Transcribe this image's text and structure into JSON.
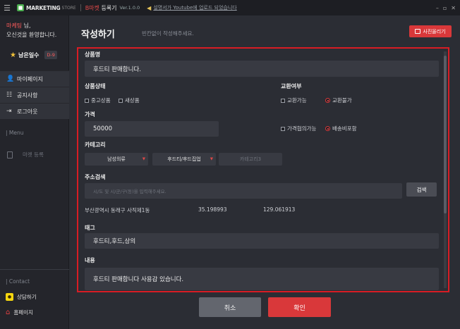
{
  "titlebar": {
    "brand": "MARKETING",
    "brand_sub": "STORE",
    "app_prefix": "B마켓",
    "app_suffix": " 등록기",
    "version": "Ver.1.0.0",
    "notice": "설명서가 Youtube에 업로드 되었습니다"
  },
  "sidebar": {
    "user_name": "마케팅",
    "user_suffix": " 님,",
    "welcome": "오신것을 환영합니다.",
    "days_label": "남은일수",
    "days_value": "D-9",
    "nav": [
      {
        "label": "마이페이지"
      },
      {
        "label": "공지사항"
      },
      {
        "label": "로그아웃"
      }
    ],
    "menu_section": "| Menu",
    "menu_item": "마켓 등록",
    "contact_section": "| Contact",
    "contact_items": [
      {
        "label": "상담하기"
      },
      {
        "label": "홈페이지"
      }
    ]
  },
  "main": {
    "title": "작성하기",
    "description": "빈칸없이 작성해주세요.",
    "photo_button": "사진올리기"
  },
  "form": {
    "product_name_label": "상품명",
    "product_name_value": "후드티 판매합니다.",
    "condition_label": "상품상태",
    "condition_options": [
      "중고상품",
      "새상품"
    ],
    "exchange_label": "교환여부",
    "exchange_options": [
      "교환가능",
      "교환불가"
    ],
    "price_label": "가격",
    "price_value": "50000",
    "price_options": [
      "가격협의가능",
      "배송비포함"
    ],
    "category_label": "카테고리",
    "category1": "남성의류",
    "category2": "후드티/후드집업",
    "category3": "카테고리3",
    "address_label": "주소검색",
    "address_placeholder": "시/도 및 시/군/구(동)을 입력해주세요.",
    "search_button": "검색",
    "address_result": "부산광역시 동래구 사직제1동",
    "latitude": "35.198993",
    "longitude": "129.061913",
    "tag_label": "태그",
    "tag_value": "후드티,후드,상의",
    "content_label": "내용",
    "content_value": "후드티 판매합니다 사용감 있습니다."
  },
  "footer": {
    "cancel": "취소",
    "confirm": "확인"
  },
  "colors": {
    "accent": "#d9383a",
    "frame": "#d81c24",
    "background": "#2b2d34",
    "sidebar": "#24252b"
  }
}
